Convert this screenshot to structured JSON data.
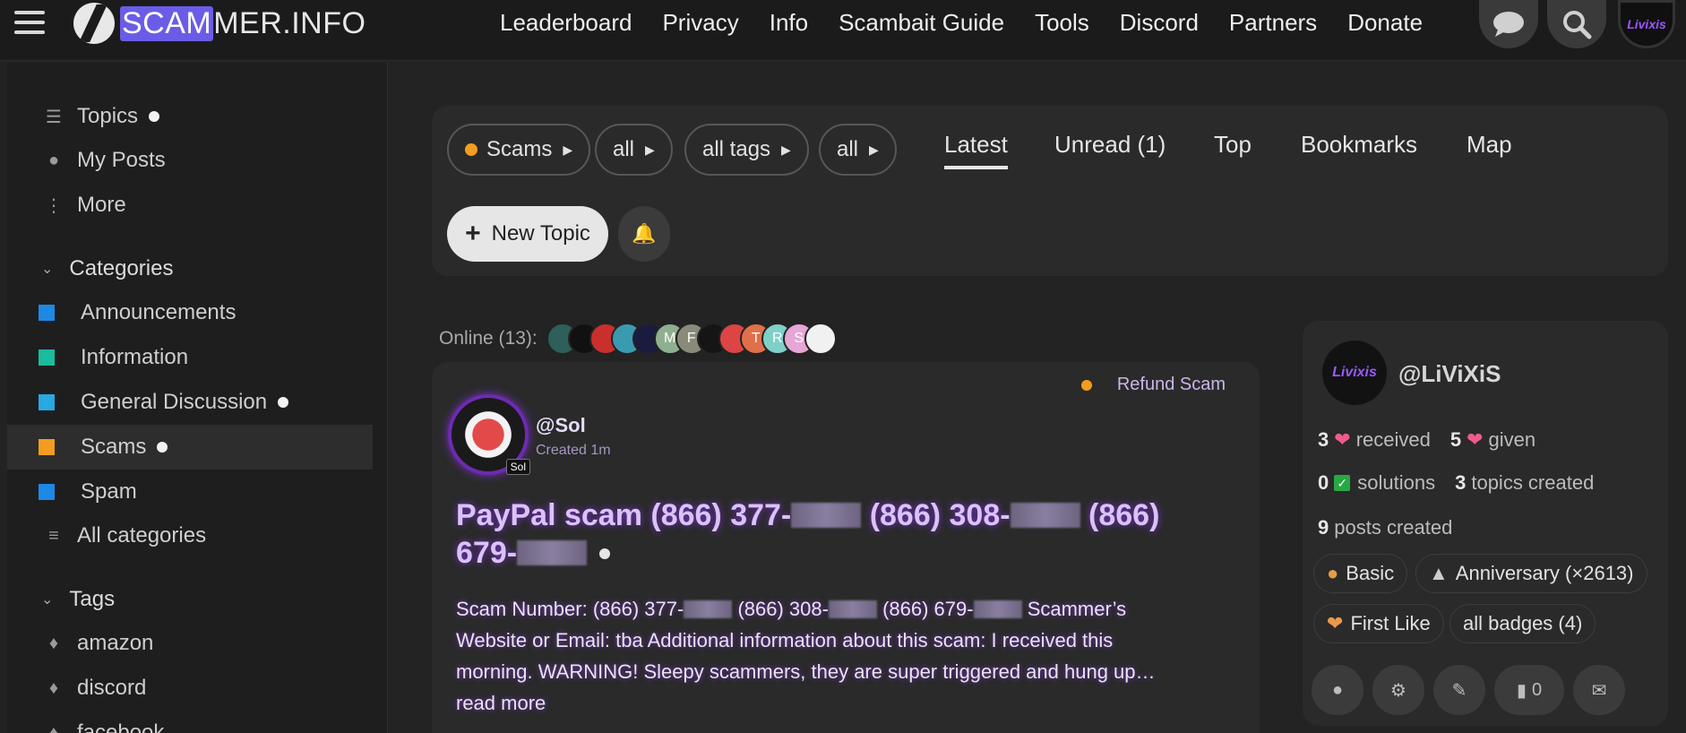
{
  "header": {
    "logo": {
      "part1": "SCAM",
      "part2": "MER.INFO"
    },
    "nav": [
      "Leaderboard",
      "Privacy",
      "Info",
      "Scambait Guide",
      "Tools",
      "Discord",
      "Partners",
      "Donate"
    ],
    "avatar_text": "Livixis"
  },
  "sidebar": {
    "top_items": [
      {
        "label": "Topics",
        "icon": "layers-icon",
        "has_dot": true
      },
      {
        "label": "My Posts",
        "icon": "user-icon",
        "has_dot": false
      },
      {
        "label": "More",
        "icon": "more-icon",
        "has_dot": false
      }
    ],
    "categories_heading": "Categories",
    "categories": [
      {
        "label": "Announcements",
        "color": "#1e88e5",
        "has_dot": false
      },
      {
        "label": "Information",
        "color": "#1abc9c",
        "has_dot": false
      },
      {
        "label": "General Discussion",
        "color": "#29a9e0",
        "has_dot": true
      },
      {
        "label": "Scams",
        "color": "#f39c1f",
        "has_dot": true,
        "active": true
      },
      {
        "label": "Spam",
        "color": "#1e88e5",
        "has_dot": false
      }
    ],
    "all_categories": "All categories",
    "tags_heading": "Tags",
    "tags": [
      "amazon",
      "discord",
      "facebook"
    ]
  },
  "filters": {
    "category": "Scams",
    "sub": "all",
    "tags": "all tags",
    "status": "all",
    "tabs": [
      "Latest",
      "Unread (1)",
      "Top",
      "Bookmarks",
      "Map"
    ],
    "active_tab": "Latest",
    "new_topic": "New Topic"
  },
  "online": {
    "label": "Online (13):",
    "avatar_initials": [
      "",
      "",
      "",
      "",
      "",
      "M",
      "F",
      "",
      "",
      "T",
      "R",
      "S",
      ""
    ]
  },
  "topic": {
    "tag": "Refund Scam",
    "author": "@Sol",
    "avatar_tag": "Sol",
    "meta": "Created 1m",
    "title_parts": [
      "PayPal scam (866) 377-",
      " (866) 308-",
      " (866) 679-"
    ],
    "excerpt_parts": [
      "Scam Number: (866) 377-",
      " (866) 308-",
      " (866) 679-",
      " Scammer’s Website or Email: tba Additional information about this scam: I received this morning. WARNING! Sleepy scammers, they are super triggered and hung up… read more"
    ]
  },
  "user_card": {
    "username": "@LiViXiS",
    "avatar_text": "Livixis",
    "received": "3",
    "received_label": "received",
    "given": "5",
    "given_label": "given",
    "solutions": "0",
    "solutions_label": "solutions",
    "topics_created": "3",
    "topics_created_label": "topics created",
    "posts_created": "9",
    "posts_created_label": "posts created",
    "badges": [
      "Basic",
      "Anniversary (×2613)",
      "First Like",
      "all badges (4)"
    ],
    "bookmark_count": "0"
  },
  "colors": {
    "accent": "#6b5ce7",
    "scams": "#f39c1f",
    "glow": "#7b2fd0",
    "heart": "#ef5b8a"
  }
}
